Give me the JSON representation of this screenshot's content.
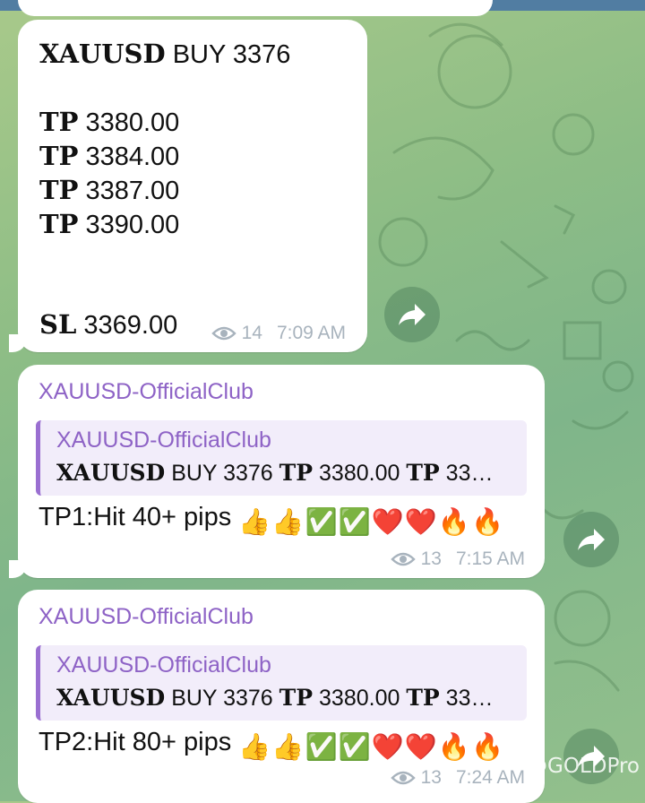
{
  "signal_message": {
    "line1_bold": "XAUUSD",
    "line1_rest": " BUY 3376",
    "tp_label": "TP",
    "tps": [
      "3380.00",
      "3384.00",
      "3387.00",
      "3390.00"
    ],
    "sl_label": "SL",
    "sl_value": "3369.00",
    "views": "14",
    "time": "7:09 AM"
  },
  "reply_messages": [
    {
      "sender": "XAUUSD-OfficialClub",
      "quoted_sender": "XAUUSD-OfficialClub",
      "quoted_bold1": "XAUUSD",
      "quoted_mid1": " BUY 3376  ",
      "quoted_bold2": "TP",
      "quoted_mid2": " 3380.00 ",
      "quoted_bold3": "TP",
      "quoted_mid3": " 33…",
      "text": "TP1:Hit 40+ pips ",
      "views": "13",
      "time": "7:15 AM"
    },
    {
      "sender": "XAUUSD-OfficialClub",
      "quoted_sender": "XAUUSD-OfficialClub",
      "quoted_bold1": "XAUUSD",
      "quoted_mid1": " BUY 3376  ",
      "quoted_bold2": "TP",
      "quoted_mid2": " 3380.00 ",
      "quoted_bold3": "TP",
      "quoted_mid3": " 33…",
      "text": "TP2:Hit 80+ pips ",
      "views": "13",
      "time": "7:24 AM"
    }
  ],
  "emojis": [
    "👍",
    "👍",
    "✅",
    "✅",
    "❤️",
    "❤️",
    "🔥",
    "🔥"
  ],
  "watermark": "@GOLDPro",
  "colors": {
    "sender": "#8e63c6",
    "reply_bar": "#9a6fd1",
    "meta": "#a8b3bd"
  },
  "icons": [
    "eye-icon",
    "forward-arrow-icon"
  ]
}
